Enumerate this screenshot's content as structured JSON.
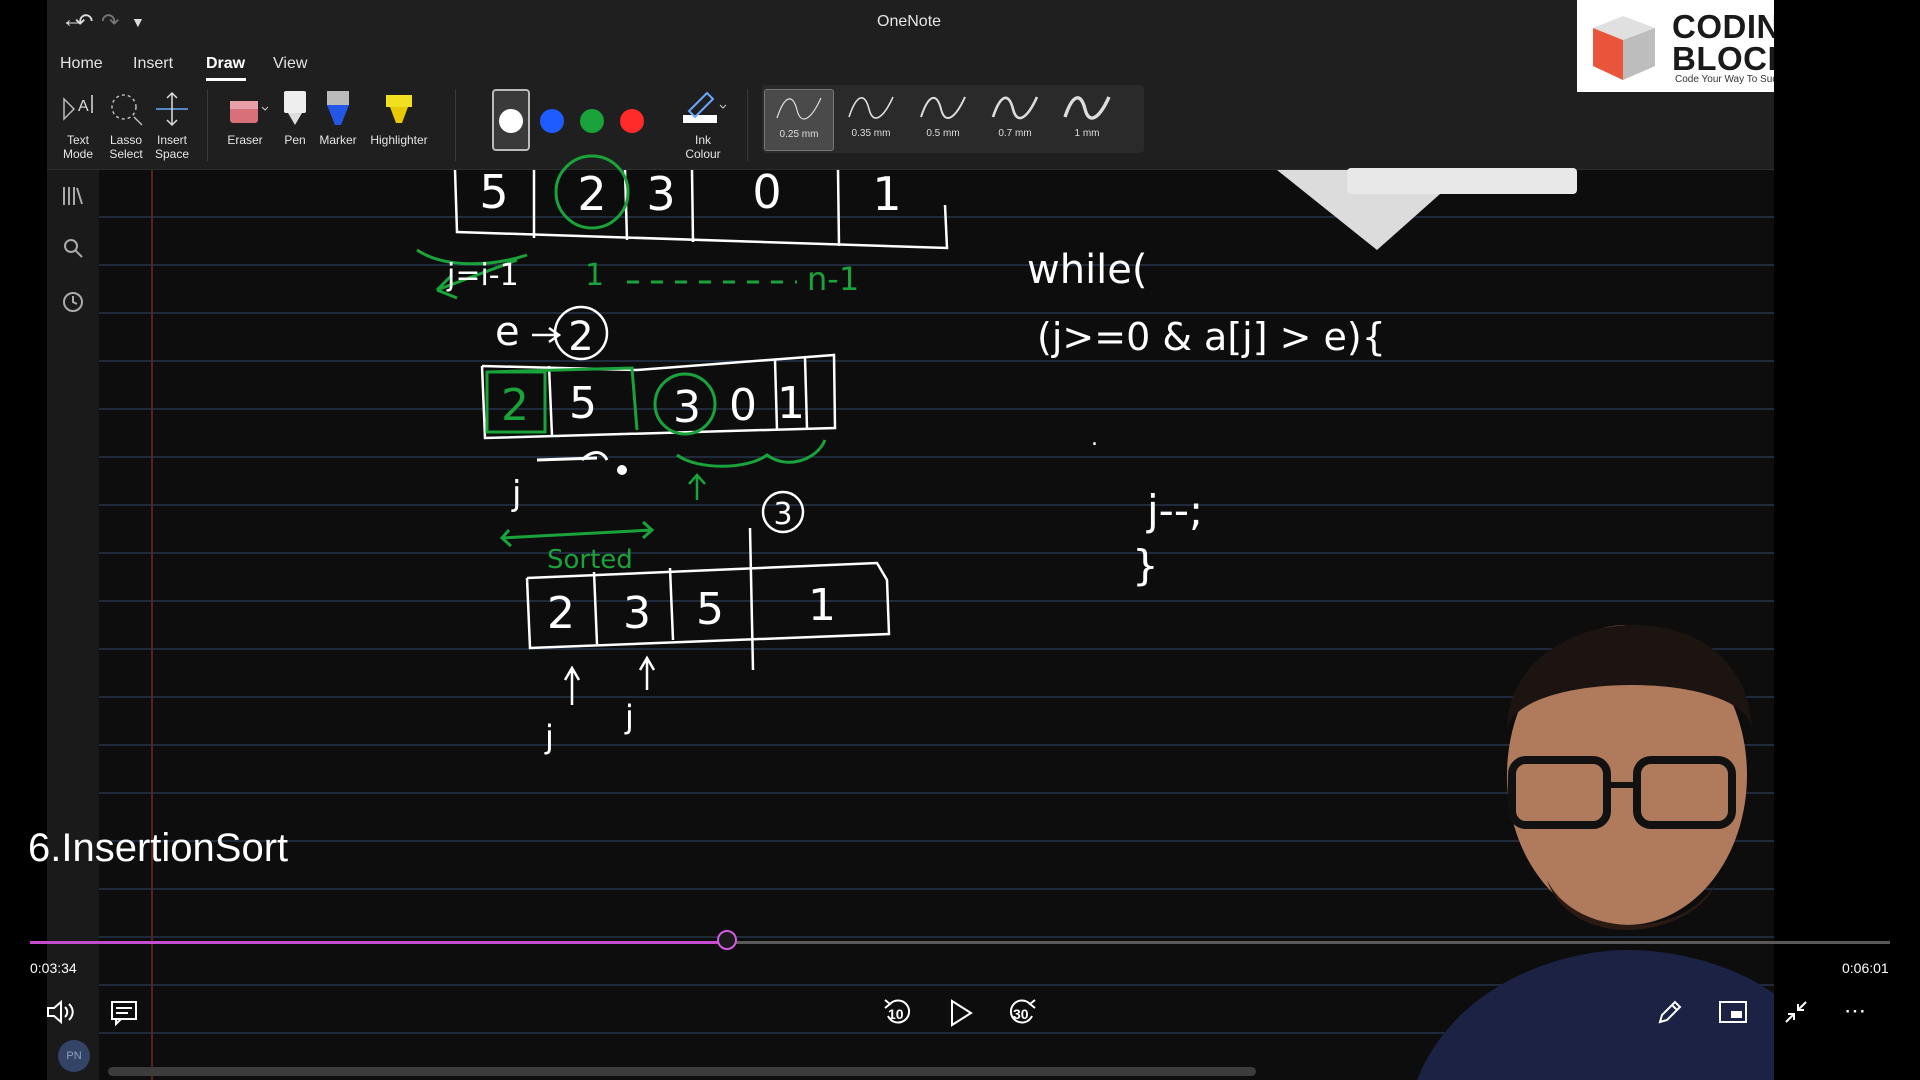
{
  "app": {
    "title": "OneNote"
  },
  "ribbon": {
    "tabs": [
      "Home",
      "Insert",
      "Draw",
      "View"
    ],
    "active_tab": "Draw",
    "tools": {
      "text_mode": [
        "Text",
        "Mode"
      ],
      "lasso_select": [
        "Lasso",
        "Select"
      ],
      "insert_space": [
        "Insert",
        "Space"
      ],
      "eraser": "Eraser",
      "pen": "Pen",
      "marker": "Marker",
      "highlighter": "Highlighter",
      "ink_colour": [
        "Ink",
        "Colour"
      ]
    },
    "colors": [
      "#ffffff",
      "#1f5cff",
      "#1aa33a",
      "#ff2b2b"
    ],
    "thickness": [
      "0.25 mm",
      "0.35 mm",
      "0.5 mm",
      "0.7 mm",
      "1 mm"
    ],
    "selected_thickness": "0.25 mm"
  },
  "logo": {
    "line1": "CODING",
    "line2": "BLOCKS",
    "tagline": "Code Your Way To Success"
  },
  "video": {
    "title": "6.InsertionSort",
    "current_time": "0:03:34",
    "total_time": "0:06:01",
    "progress": 0.3748,
    "skip_back": "10",
    "skip_forward": "30",
    "avatar_initials": "PN"
  },
  "note": {
    "row1": [
      "5",
      "2",
      "3",
      "0",
      "1"
    ],
    "j_eq": "j=i-1",
    "range_start": "1",
    "range_end": "n-1",
    "e_label": "e",
    "e_val": "2",
    "row2": [
      "2",
      "5",
      "3",
      "0",
      "1"
    ],
    "j_label": "j",
    "circled_3": "3",
    "sorted_label": "Sorted",
    "row3": [
      "2",
      "3",
      "5",
      "1"
    ],
    "j1": "j",
    "j2": "j",
    "while_text": "while(",
    "cond_text": "(j>=0 & a[j] > e){",
    "dot": ".",
    "jdec": "j--;",
    "brace": "}"
  }
}
